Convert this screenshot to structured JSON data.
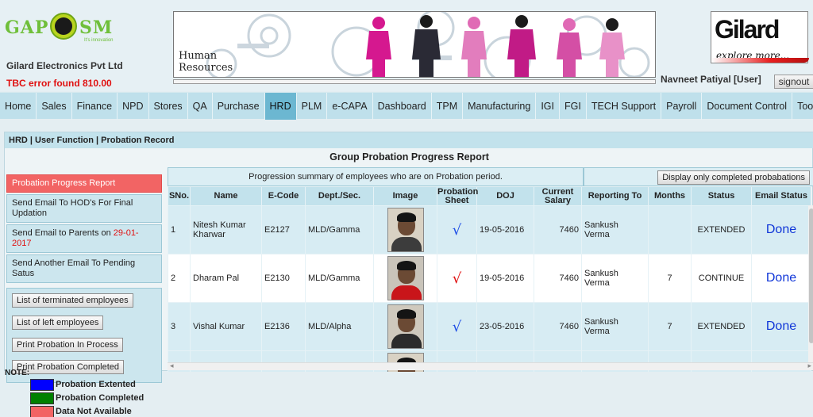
{
  "header": {
    "logo_letters_left": "GAP",
    "logo_letter_center": "O",
    "logo_letters_right": "SM",
    "logo_tagline": "It's innovation",
    "company": "Gilard Electronics Pvt Ltd",
    "tbc_error": "TBC error found 810.00",
    "banner_text_line1": "Human",
    "banner_text_line2": "Resources",
    "brand_name": "Gilard",
    "brand_slogan": "explore more...",
    "user": "Navneet Patiyal [User]",
    "signout_label": "signout"
  },
  "nav": {
    "items": [
      "Home",
      "Sales",
      "Finance",
      "NPD",
      "Stores",
      "QA",
      "Purchase",
      "HRD",
      "PLM",
      "e-CAPA",
      "Dashboard",
      "TPM",
      "Manufacturing",
      "IGI",
      "FGI",
      "TECH Support",
      "Payroll",
      "Document Control",
      "Tool Room"
    ],
    "active": "HRD"
  },
  "breadcrumb": "HRD | User Function | Probation Record",
  "report_title": "Group Probation Progress Report",
  "left_menu": {
    "items": [
      {
        "label": "Probation Progress Report"
      },
      {
        "label": "Send Email To HOD's For Final Updation"
      },
      {
        "label": "Send Email to Parents on ",
        "date": "29-01-2017"
      },
      {
        "label": "Send Another Email To Pending Satus"
      }
    ],
    "buttons": [
      "List of terminated employees",
      "List of left employees",
      "Print Probation In Process",
      "Print Probation Completed"
    ]
  },
  "table": {
    "summary": "Progression summary of employees who are on Probation period.",
    "display_button": "Display only completed probabations",
    "columns": [
      "SNo.",
      "Name",
      "E-Code",
      "Dept./Sec.",
      "Image",
      "Probation Sheet",
      "DOJ",
      "Current Salary",
      "Reporting To",
      "Months",
      "Status",
      "Email Status"
    ],
    "rows": [
      {
        "sno": "1",
        "name": "Nitesh Kumar Kharwar",
        "ecode": "E2127",
        "dept": "MLD/Gamma",
        "sheet": "√",
        "sheet_color": "blue",
        "doj": "19-05-2016",
        "salary": "7460",
        "reporting_to": "Sankush Verma",
        "months": "",
        "status": "EXTENDED",
        "email_status": "Done"
      },
      {
        "sno": "2",
        "name": "Dharam Pal",
        "ecode": "E2130",
        "dept": "MLD/Gamma",
        "sheet": "√",
        "sheet_color": "red",
        "doj": "19-05-2016",
        "salary": "7460",
        "reporting_to": "Sankush Verma",
        "months": "7",
        "status": "CONTINUE",
        "email_status": "Done"
      },
      {
        "sno": "3",
        "name": "Vishal Kumar",
        "ecode": "E2136",
        "dept": "MLD/Alpha",
        "sheet": "√",
        "sheet_color": "blue",
        "doj": "23-05-2016",
        "salary": "7460",
        "reporting_to": "Sankush Verma",
        "months": "7",
        "status": "EXTENDED",
        "email_status": "Done"
      }
    ]
  },
  "note": {
    "label": "NOTE:",
    "legend": [
      {
        "label": "Probation Extented",
        "color": "#0000ff"
      },
      {
        "label": "Probation Completed",
        "color": "#008000"
      },
      {
        "label": "Data Not Available",
        "color": "#f26464"
      }
    ]
  },
  "colors": {
    "nav_active": "#6cb7d1",
    "menu_active": "#f26464",
    "error_text": "#e01010",
    "done_link": "#1036d8"
  }
}
